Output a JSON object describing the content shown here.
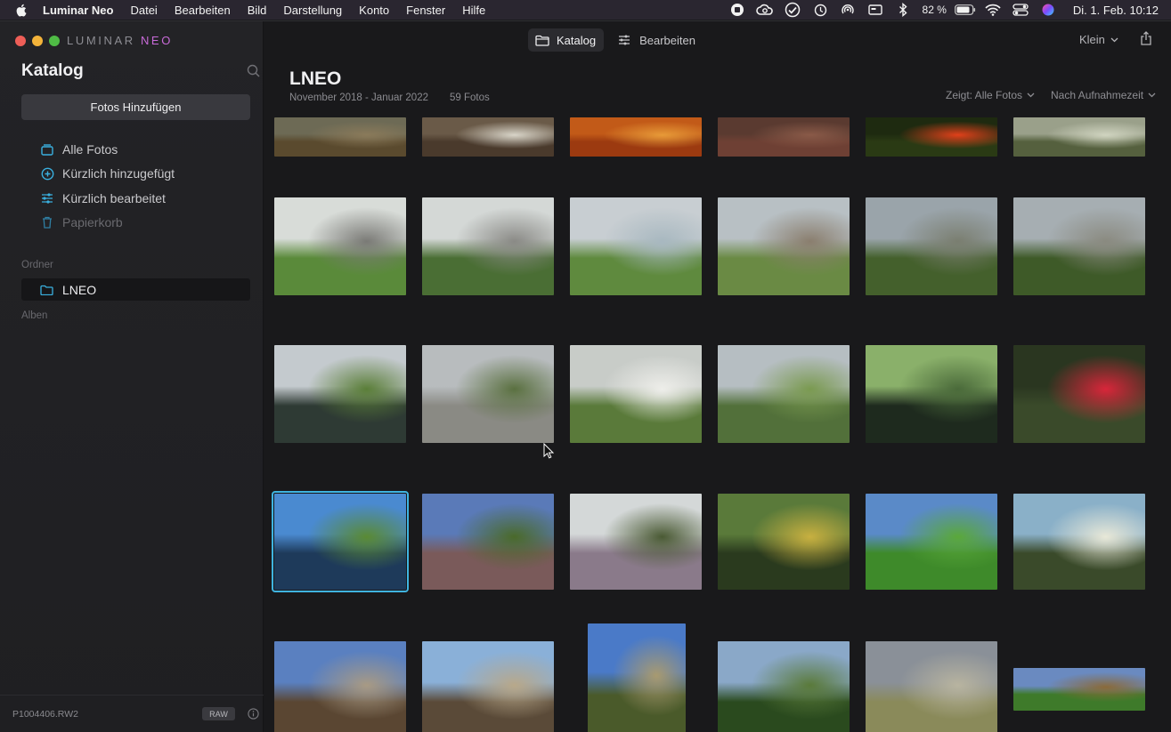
{
  "menubar": {
    "app_name": "Luminar Neo",
    "menus": [
      "Datei",
      "Bearbeiten",
      "Bild",
      "Darstellung",
      "Konto",
      "Fenster",
      "Hilfe"
    ],
    "battery": "82 %",
    "datetime": "Di. 1. Feb.  10:12",
    "icons": [
      "record-icon",
      "creative-cloud-icon",
      "checkmark-circle-icon",
      "time-machine-icon",
      "airdrop-icon",
      "display-icon",
      "bluetooth-icon",
      "battery-icon",
      "wifi-icon",
      "control-center-icon",
      "siri-icon"
    ]
  },
  "window": {
    "logo_text": "LUMINAR",
    "logo_accent": "NEO",
    "tabs": [
      {
        "label": "Katalog",
        "icon": "folder-icon",
        "active": true
      },
      {
        "label": "Bearbeiten",
        "icon": "sliders-icon",
        "active": false
      }
    ],
    "size_label": "Klein"
  },
  "sidebar": {
    "title": "Katalog",
    "add_button": "Fotos Hinzufügen",
    "items": [
      {
        "label": "Alle Fotos",
        "icon": "photos-stack-icon",
        "enabled": true
      },
      {
        "label": "Kürzlich hinzugefügt",
        "icon": "plus-circle-icon",
        "enabled": true
      },
      {
        "label": "Kürzlich bearbeitet",
        "icon": "sliders-icon",
        "enabled": true
      },
      {
        "label": "Papierkorb",
        "icon": "trash-icon",
        "enabled": false
      }
    ],
    "folders_label": "Ordner",
    "folder": "LNEO",
    "albums_label": "Alben",
    "footer": {
      "filename": "P1004406.RW2",
      "badge": "RAW"
    }
  },
  "catalog": {
    "title": "LNEO",
    "date_range": "November 2018 - Januar 2022",
    "count": "59 Fotos",
    "filter_label": "Zeigt: Alle Fotos",
    "sort_label": "Nach Aufnahmezeit"
  },
  "photos": [
    {
      "desc": "heath-path",
      "sky": "#6d6a55",
      "ground": "#5a4a2e",
      "accent": "#8a7a5a"
    },
    {
      "desc": "mushrooms-leaves",
      "sky": "#6a5a48",
      "ground": "#4a3a2c",
      "accent": "#d8d4c8"
    },
    {
      "desc": "autumn-leaves",
      "sky": "#c25a18",
      "ground": "#9c3a10",
      "accent": "#e79a38"
    },
    {
      "desc": "brown-leaves",
      "sky": "#5a3a30",
      "ground": "#6e4034",
      "accent": "#8a5a48"
    },
    {
      "desc": "red-flowers",
      "sky": "#1e2a10",
      "ground": "#2a3a14",
      "accent": "#e0401a"
    },
    {
      "desc": "branch-bokeh",
      "sky": "#9aa08a",
      "ground": "#55603e",
      "accent": "#d0d4c0"
    },
    {
      "desc": "stone-columns-1",
      "sky": "#d8dcd8",
      "ground": "#5a8a3a",
      "accent": "#7a7a76"
    },
    {
      "desc": "stone-columns-2",
      "sky": "#d4d8d6",
      "ground": "#4a6e34",
      "accent": "#8a8a86"
    },
    {
      "desc": "moor-pond",
      "sky": "#c8ced2",
      "ground": "#5f8a3e",
      "accent": "#a8b8c0"
    },
    {
      "desc": "wooden-rail-ball",
      "sky": "#b8c0c4",
      "ground": "#6a8a44",
      "accent": "#8a7e6e"
    },
    {
      "desc": "dead-tree-pond",
      "sky": "#9aa4aa",
      "ground": "#44602c",
      "accent": "#7a7e70"
    },
    {
      "desc": "dead-tree-pond-2",
      "sky": "#a6aeb2",
      "ground": "#3e5a28",
      "accent": "#8a8a80"
    },
    {
      "desc": "moor-lake",
      "sky": "#c4cace",
      "ground": "#2e3a34",
      "accent": "#5a7e38"
    },
    {
      "desc": "boardwalk",
      "sky": "#b8bcbe",
      "ground": "#8a8a84",
      "accent": "#5a7040"
    },
    {
      "desc": "birch-meadow",
      "sky": "#c8ccc8",
      "ground": "#5a7a3a",
      "accent": "#eeeeea"
    },
    {
      "desc": "moor-water-grass",
      "sky": "#b6bec2",
      "ground": "#52703a",
      "accent": "#7a9a50"
    },
    {
      "desc": "forest-swamp",
      "sky": "#8ab06a",
      "ground": "#1e2a1e",
      "accent": "#4a6a3a"
    },
    {
      "desc": "dragonfly-post",
      "sky": "#2a3620",
      "ground": "#3a4a2a",
      "accent": "#d8263a"
    },
    {
      "desc": "pond-blue-sky",
      "sky": "#4a8ad0",
      "ground": "#1e3a5a",
      "accent": "#5a8a34"
    },
    {
      "desc": "heath-tree",
      "sky": "#5a7ab8",
      "ground": "#7a5a5a",
      "accent": "#4a6a2a"
    },
    {
      "desc": "heath-purple",
      "sky": "#d4d8d8",
      "ground": "#8a7a8a",
      "accent": "#4a5a34"
    },
    {
      "desc": "autumn-forest",
      "sky": "#5a7a3a",
      "ground": "#2a3a1e",
      "accent": "#c8b040"
    },
    {
      "desc": "park-meadow",
      "sky": "#5a8ac8",
      "ground": "#3e8a2a",
      "accent": "#5aa83a"
    },
    {
      "desc": "sun-tree",
      "sky": "#8ab0c8",
      "ground": "#3a4a2a",
      "accent": "#e8e8d8"
    },
    {
      "desc": "cut-field-1",
      "sky": "#5a80c0",
      "ground": "#5a4632",
      "accent": "#a89a84"
    },
    {
      "desc": "cut-field-2",
      "sky": "#8ab0d8",
      "ground": "#5a4a38",
      "accent": "#b8a88a"
    },
    {
      "desc": "tall-trees-up",
      "sky": "#4a7ac8",
      "ground": "#4a5a2a",
      "accent": "#a89a70"
    },
    {
      "desc": "forest-sunburst",
      "sky": "#8aa8c8",
      "ground": "#2a4a1e",
      "accent": "#5a7a3a"
    },
    {
      "desc": "field-path-cloudy",
      "sky": "#8a9098",
      "ground": "#8a8a5a",
      "accent": "#b8b4a0"
    },
    {
      "desc": "panorama-fields",
      "sky": "#6a8ac0",
      "ground": "#3e7a2a",
      "accent": "#8a6a3a"
    }
  ]
}
